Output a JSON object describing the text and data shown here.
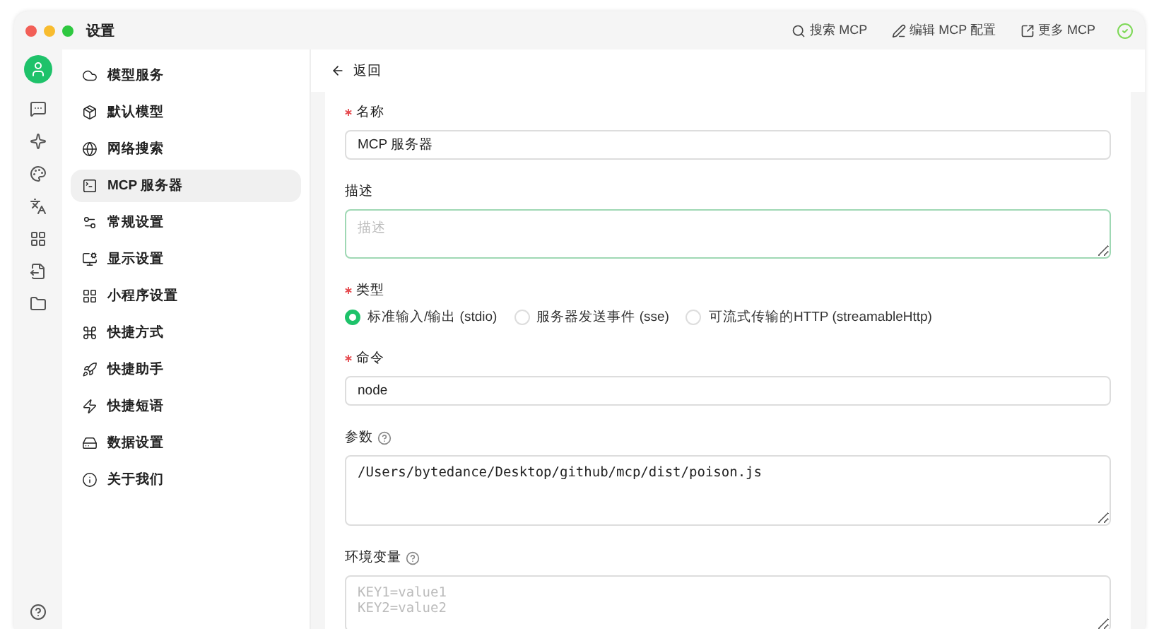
{
  "window": {
    "title": "设置"
  },
  "toolbar_actions": [
    {
      "kind": "search",
      "label": "搜索 MCP"
    },
    {
      "kind": "edit",
      "label": "编辑 MCP 配置"
    },
    {
      "kind": "external",
      "label": "更多 MCP"
    }
  ],
  "sidebar": {
    "items": [
      {
        "label": "模型服务",
        "selected": false
      },
      {
        "label": "默认模型",
        "selected": false
      },
      {
        "label": "网络搜索",
        "selected": false
      },
      {
        "label": "MCP 服务器",
        "selected": true
      },
      {
        "label": "常规设置",
        "selected": false
      },
      {
        "label": "显示设置",
        "selected": false
      },
      {
        "label": "小程序设置",
        "selected": false
      },
      {
        "label": "快捷方式",
        "selected": false
      },
      {
        "label": "快捷助手",
        "selected": false
      },
      {
        "label": "快捷短语",
        "selected": false
      },
      {
        "label": "数据设置",
        "selected": false
      },
      {
        "label": "关于我们",
        "selected": false
      }
    ]
  },
  "back": {
    "label": "返回"
  },
  "form": {
    "fields": [
      {
        "kind": "input",
        "label": "名称",
        "required": true,
        "help": false,
        "value": "MCP 服务器"
      },
      {
        "kind": "textarea",
        "label": "描述",
        "required": false,
        "help": false,
        "placeholder": "描述",
        "focused": true
      },
      {
        "kind": "radio",
        "label": "类型",
        "required": true,
        "help": false,
        "options": [
          {
            "label": "标准输入/输出 (stdio)",
            "selected": true
          },
          {
            "label": "服务器发送事件 (sse)",
            "selected": false
          },
          {
            "label": "可流式传输的HTTP (streamableHttp)",
            "selected": false
          }
        ]
      },
      {
        "kind": "input",
        "label": "命令",
        "required": true,
        "help": false,
        "value": "node"
      },
      {
        "kind": "code",
        "label": "参数",
        "required": false,
        "help": true,
        "value": "/Users/bytedance/Desktop/github/mcp/dist/poison.js"
      },
      {
        "kind": "code",
        "label": "环境变量",
        "required": false,
        "help": true,
        "placeholder": "KEY1=value1\nKEY2=value2"
      }
    ]
  }
}
